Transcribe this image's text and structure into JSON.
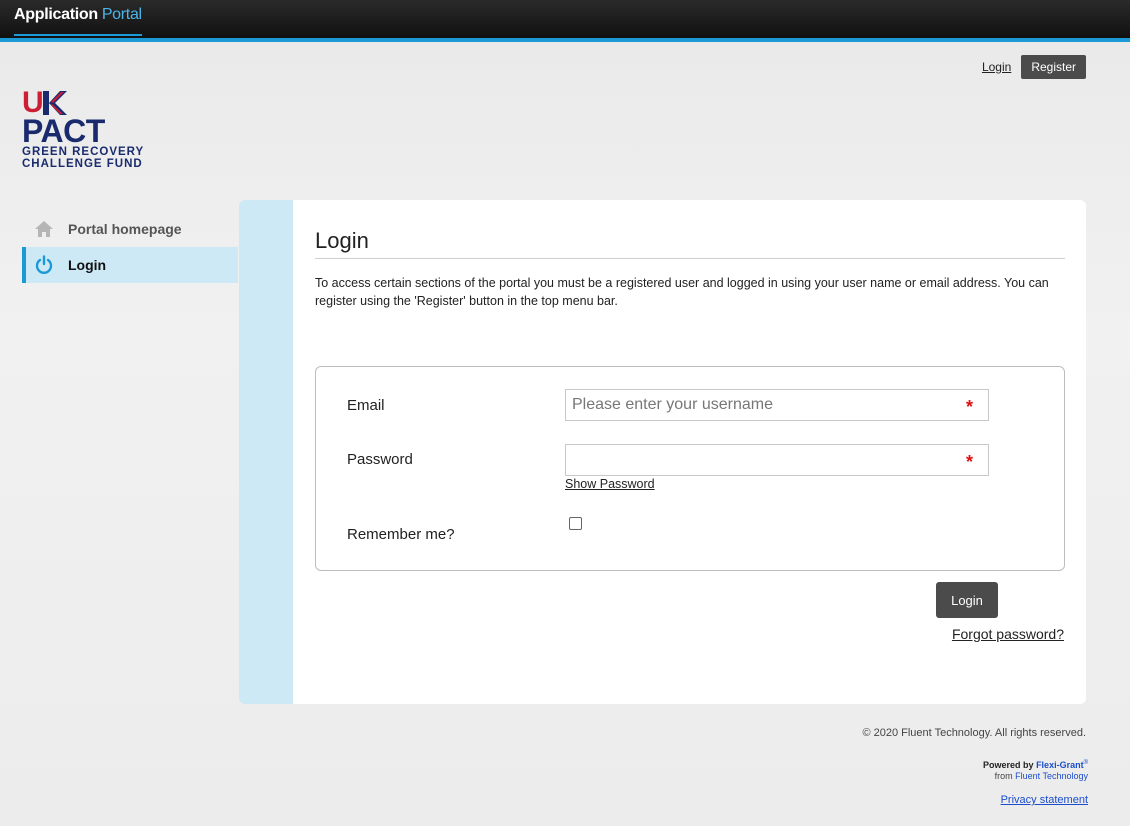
{
  "topbar": {
    "brand_strong": "Application",
    "brand_light": "Portal"
  },
  "header": {
    "login_link": "Login",
    "register_button": "Register"
  },
  "logo": {
    "line1_a": "UK",
    "line2": "PACT",
    "line3": "GREEN RECOVERY",
    "line4": "CHALLENGE FUND"
  },
  "sidebar": {
    "items": [
      {
        "label": "Portal homepage",
        "icon": "home-icon"
      },
      {
        "label": "Login",
        "icon": "power-icon"
      }
    ]
  },
  "main": {
    "title": "Login",
    "intro": "To access certain sections of the portal you must be a registered user and logged in using your user name or email address. You can register using the 'Register' button in the top menu bar.",
    "form": {
      "email_label": "Email",
      "email_placeholder": "Please enter your username",
      "password_label": "Password",
      "show_password": "Show Password",
      "remember_label": "Remember me?",
      "required_mark": "*"
    },
    "login_button": "Login",
    "forgot_link": "Forgot password?"
  },
  "footer": {
    "copyright": "© 2020 Fluent Technology. All rights reserved.",
    "powered_label": "Powered by",
    "powered_brand": "Flexi-Grant",
    "powered_reg": "®",
    "from_label": "from",
    "from_company": "Fluent Technology",
    "privacy": "Privacy statement"
  },
  "colors": {
    "accent": "#1b9ad6",
    "sidebar_active": "#cde9f6",
    "button": "#4b4b4b",
    "required": "#dd1111"
  }
}
